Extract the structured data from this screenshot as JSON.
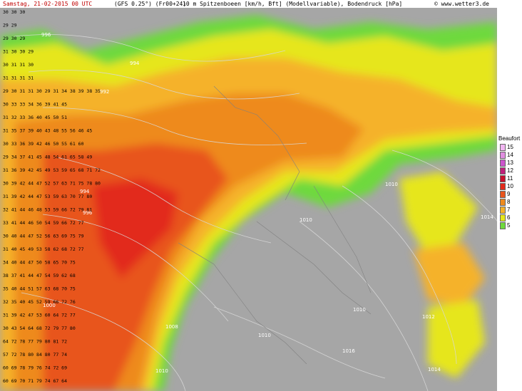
{
  "header": {
    "date": "Samstag, 21-02-2015   00 UTC",
    "model": "(GFS 0.25°) (Fr00+24)",
    "parameter": "10 m Spitzenboeen [km/h, Bft] (Modellvariable), Bodendruck [hPa]",
    "site": "© www.wetter3.de"
  },
  "legend": {
    "title": "Beaufort",
    "levels": [
      {
        "label": "15",
        "color": "#f2b6f2"
      },
      {
        "label": "14",
        "color": "#e08ee0"
      },
      {
        "label": "13",
        "color": "#cc55cc"
      },
      {
        "label": "12",
        "color": "#c0207a"
      },
      {
        "label": "11",
        "color": "#c8102e"
      },
      {
        "label": "10",
        "color": "#e22a1a"
      },
      {
        "label": "9",
        "color": "#e8541c"
      },
      {
        "label": "8",
        "color": "#ee8a1e"
      },
      {
        "label": "7",
        "color": "#f5b22a"
      },
      {
        "label": "6",
        "color": "#e6e61a"
      },
      {
        "label": "5",
        "color": "#6ed93c"
      }
    ]
  },
  "isobars": {
    "labels": [
      {
        "text": "996"
      },
      {
        "text": "994"
      },
      {
        "text": "992"
      },
      {
        "text": "994"
      },
      {
        "text": "996"
      },
      {
        "text": "1000"
      },
      {
        "text": "1008"
      },
      {
        "text": "1010"
      },
      {
        "text": "1010"
      },
      {
        "text": "1010"
      },
      {
        "text": "1010"
      },
      {
        "text": "1012"
      },
      {
        "text": "1014"
      },
      {
        "text": "1016"
      },
      {
        "text": "1014"
      },
      {
        "text": "1010"
      }
    ]
  },
  "grid_values": {
    "rows": [
      "30 30 30",
      "29 29",
      "29 30 29",
      "31 30 30 29",
      "30 31 31 30",
      "31 31 31 31",
      "29 30 31 31 30 29 31 34 38 39 38 35",
      "30 33 33 34 36 39 41 45",
      "31 32 33 36 40 45 50 51",
      "31 35 37 39 40 43 48 55 56 46 45",
      "30 33 36 39 42 46 50 55 61 60",
      "29 34 37 41 45 48 54 61 65 58 49",
      "31 36 39 42 45 49 53 59 65 68 71 72",
      "30 39 42 44 47 52 57 63 71 75 78 80",
      "31 39 42 44 47 53 59 63 70 77 80",
      "32 41 44 46 48 53 59 66 72 79 81",
      "33 41 44 46 50 54 59 66 72 77",
      "30 40 44 47 52 56 63 69 75 79",
      "31 40 45 49 53 58 62 68 72 77",
      "34 40 44 47 50 58 65 70 75",
      "38 37 41 44 47 54 59 62 68",
      "35 40 44 51 57 63 68 70 75",
      "32 35 40 45 52 59 66 72 76",
      "31 39 42 47 53 60 64 72 77",
      "30 43 54 64 68 72 79 77 80",
      "64 72 78 77 79 80 81 72",
      "57 72 78 80 84 80 77 74",
      "60 69 78 79 76 74 72 69",
      "60 69 70 71 79 74 67 64"
    ]
  }
}
